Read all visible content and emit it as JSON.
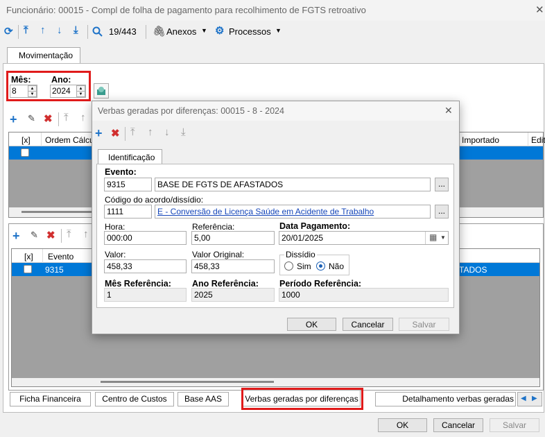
{
  "window": {
    "title": "Funcionário: 00015 - Compl de folha de pagamento para recolhimento de FGTS retroativo",
    "close_glyph": "✕"
  },
  "toolbar": {
    "record_counter": "19/443",
    "attachments_label": "Anexos",
    "processes_label": "Processos"
  },
  "main_tab": {
    "label": "Movimentação"
  },
  "period": {
    "month_label": "Mês:",
    "month_value": "8",
    "year_label": "Ano:",
    "year_value": "2024"
  },
  "upper_grid": {
    "columns": [
      "[x]",
      "Ordem Cálculo",
      "Importado",
      "Edit"
    ]
  },
  "lower_grid": {
    "columns": [
      "[x]",
      "Evento"
    ],
    "row": {
      "evento": "9315",
      "desc_tail": "TADOS"
    }
  },
  "bottom_tabs": [
    "Ficha Financeira",
    "Centro de Custos",
    "Base AAS",
    "Verbas geradas por diferenças",
    "Detalhamento verbas geradas"
  ],
  "footer": {
    "ok": "OK",
    "cancel": "Cancelar",
    "save": "Salvar"
  },
  "dialog": {
    "title": "Verbas geradas por diferenças: 00015 - 8 - 2024",
    "close_glyph": "✕",
    "tab": "Identificação",
    "evento_label": "Evento:",
    "evento_code": "9315",
    "evento_desc": "BASE DE FGTS DE AFASTADOS",
    "acordo_label": "Código do acordo/dissídio:",
    "acordo_code": "1111",
    "acordo_desc": "E - Conversão de Licença Saúde em Acidente de Trabalho",
    "ellipsis": "...",
    "hora_label": "Hora:",
    "hora_value": "000:00",
    "referencia_label": "Referência:",
    "referencia_value": "5,00",
    "data_pag_label": "Data Pagamento:",
    "data_pag_value": "20/01/2025",
    "valor_label": "Valor:",
    "valor_value": "458,33",
    "valor_orig_label": "Valor Original:",
    "valor_orig_value": "458,33",
    "dissidio_label": "Dissídio",
    "sim_label": "Sim",
    "nao_label": "Não",
    "dissidio_selected": "Não",
    "mes_ref_label": "Mês Referência:",
    "mes_ref_value": "1",
    "ano_ref_label": "Ano Referência:",
    "ano_ref_value": "2025",
    "periodo_ref_label": "Período Referência:",
    "periodo_ref_value": "1000",
    "ok": "OK",
    "cancel": "Cancelar",
    "save": "Salvar"
  },
  "colors": {
    "accent": "#1e73c8",
    "selection": "#0078d7",
    "highlight_box": "#e01b1b",
    "delete": "#d12f2f"
  }
}
